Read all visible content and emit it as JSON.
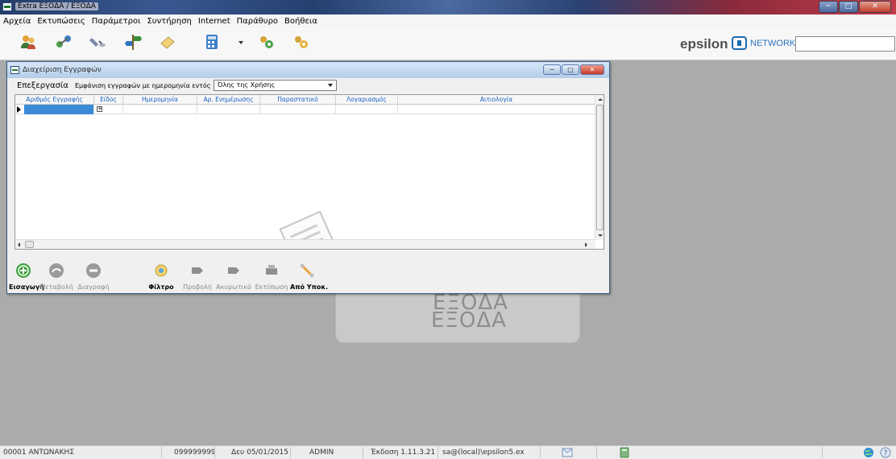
{
  "app": {
    "title": "Extra ΕΞΟΔΑ / ΕΞΟΔΑ"
  },
  "menu": {
    "items": [
      "Αρχεία",
      "Εκτυπώσεις",
      "Παράμετροι",
      "Συντήρηση",
      "Internet",
      "Παράθυρο",
      "Βοήθεια"
    ]
  },
  "toolbar": {
    "icons": [
      "users-icon",
      "network-icon",
      "satellite-icon",
      "signpost-icon",
      "eraser-icon",
      "calculator-icon",
      "dropdown-arrow-icon",
      "gear-green-icon",
      "gears-icon"
    ]
  },
  "logo": {
    "brand": "epsilon",
    "network": "NETWORK"
  },
  "ghost_logo": {
    "line1": "ΕΞΟΔΑ",
    "line2": "ΕΞΟΔΑ"
  },
  "child_window": {
    "title": "Διαχείριση Εγγραφών",
    "menu_label": "Επεξεργασία",
    "filter_label": "Εμφάνιση εγγραφών με ημερομηνία εντός",
    "filter_value": "Όλης της Χρήσης"
  },
  "grid": {
    "columns": [
      "Αριθμός Εγγραφής",
      "Είδος",
      "Ημερομηνία",
      "Αρ. Ενημέρωσης",
      "Παραστατικό",
      "Λογαριασμός",
      "Αιτιολογία"
    ]
  },
  "actions": [
    {
      "label": "Εισαγωγή",
      "icon": "add-icon",
      "enabled": true
    },
    {
      "label": "Μεταβολή",
      "icon": "edit-icon",
      "enabled": false
    },
    {
      "label": "Διαγραφή",
      "icon": "delete-icon",
      "enabled": false
    },
    {
      "label": "Φίλτρο",
      "icon": "filter-icon",
      "enabled": true
    },
    {
      "label": "Προβολή",
      "icon": "view-icon",
      "enabled": false
    },
    {
      "label": "Ακυρωτικό",
      "icon": "cancel-doc-icon",
      "enabled": false
    },
    {
      "label": "Εκτύπωση",
      "icon": "print-icon",
      "enabled": false
    },
    {
      "label": "Από Υποκ.",
      "icon": "wrench-icon",
      "enabled": true
    }
  ],
  "status": {
    "company": "00001 ΑΝΤΩΝΑΚΗΣ",
    "code": "099999999",
    "date": "Δευ 05/01/2015",
    "user": "ADMIN",
    "version": "Έκδοση 1.11.3.21",
    "connection": "sa@(local)\\epsilon5.ex"
  },
  "colors": {
    "selection": "#3a8ad6",
    "grid_header_text": "#1a5fbf",
    "desktop": "#ababab"
  }
}
